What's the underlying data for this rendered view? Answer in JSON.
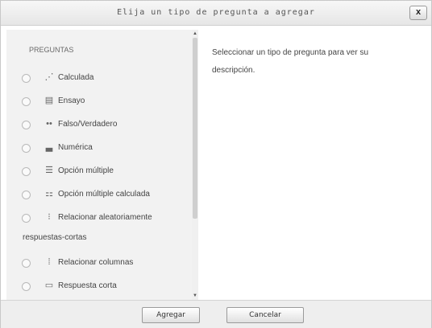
{
  "dialog": {
    "title": "Elija un tipo de pregunta a agregar",
    "close_label": "x"
  },
  "sidebar": {
    "heading": "PREGUNTAS",
    "options": [
      {
        "label": "Calculada",
        "icon": "calculated-icon",
        "glyph": "⋰"
      },
      {
        "label": "Ensayo",
        "icon": "essay-icon",
        "glyph": "▤"
      },
      {
        "label": "Falso/Verdadero",
        "icon": "truefalse-icon",
        "glyph": "••"
      },
      {
        "label": "Numérica",
        "icon": "numeric-icon",
        "glyph": "▃"
      },
      {
        "label": "Opción múltiple",
        "icon": "multichoice-icon",
        "glyph": "☰"
      },
      {
        "label": "Opción múltiple calculada",
        "icon": "calculated-multichoice-icon",
        "glyph": "⚏"
      },
      {
        "label": "Relacionar aleatoriamente",
        "icon": "random-match-icon",
        "glyph": "⁝"
      },
      {
        "label": "Relacionar columnas",
        "icon": "match-icon",
        "glyph": "⁞"
      },
      {
        "label": "Respuesta corta",
        "icon": "shortanswer-icon",
        "glyph": "▭"
      }
    ],
    "wrap_text": "respuestas-cortas"
  },
  "main": {
    "description": "Seleccionar un tipo de pregunta para ver su descripción."
  },
  "footer": {
    "add_label": "Agregar",
    "cancel_label": "Cancelar"
  }
}
